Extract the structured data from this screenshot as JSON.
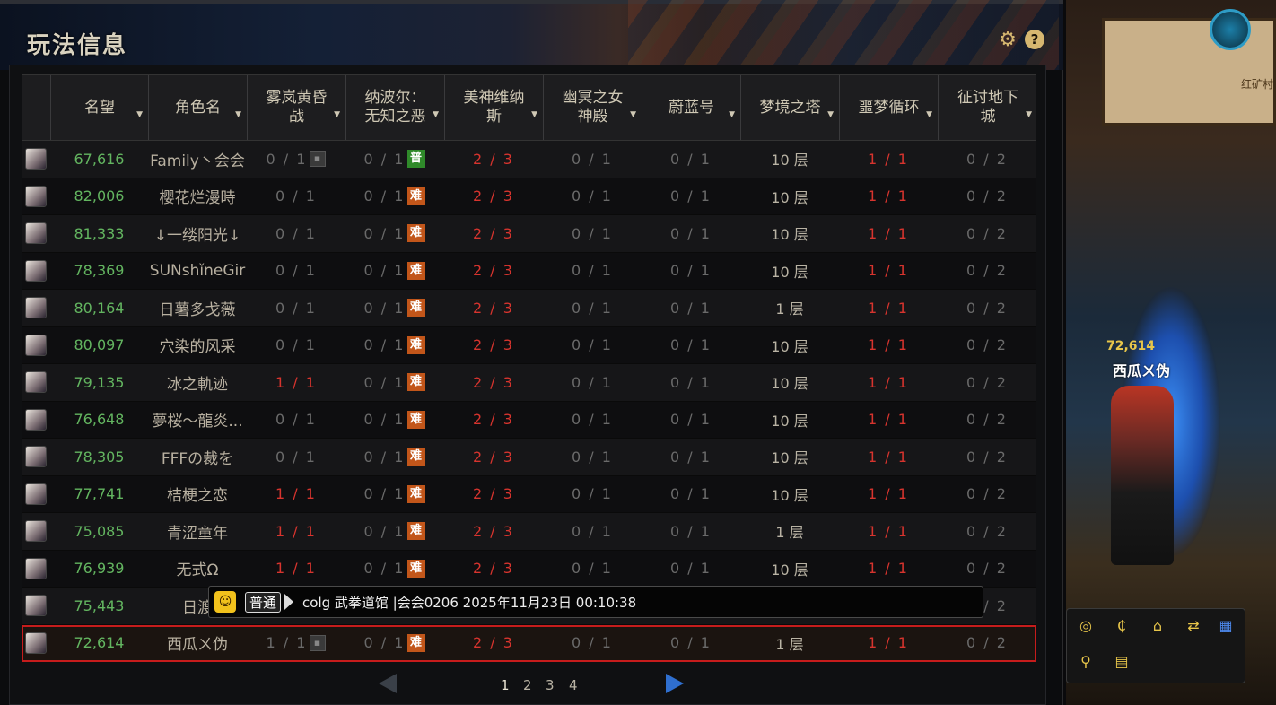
{
  "window": {
    "title": "玩法信息"
  },
  "header": {
    "columns": [
      {
        "label": "名望"
      },
      {
        "label": "角色名"
      },
      {
        "label": "雾岚黄昏战"
      },
      {
        "label": "纳波尔：无知之恶"
      },
      {
        "label": "美神维纳斯"
      },
      {
        "label": "幽冥之女神殿"
      },
      {
        "label": "蔚蓝号"
      },
      {
        "label": "梦境之塔"
      },
      {
        "label": "噩梦循环"
      },
      {
        "label": "征讨地下城"
      }
    ]
  },
  "rows": [
    {
      "fame": "67,616",
      "name": "Family丶会会",
      "c1": "0 / 1",
      "c1_lock": "🔒",
      "c2": "0 / 1",
      "c2_tag": "普",
      "c3": "2 / 3",
      "c4": "0 / 1",
      "c5": "0 / 1",
      "c6": "10 层",
      "c7": "1 / 1",
      "c8": "0 / 2"
    },
    {
      "fame": "82,006",
      "name": "樱花烂漫時",
      "c1": "0 / 1",
      "c2": "0 / 1",
      "c2_tag": "难",
      "c3": "2 / 3",
      "c4": "0 / 1",
      "c5": "0 / 1",
      "c6": "10 层",
      "c7": "1 / 1",
      "c8": "0 / 2"
    },
    {
      "fame": "81,333",
      "name": "↓一缕阳光↓",
      "c1": "0 / 1",
      "c2": "0 / 1",
      "c2_tag": "难",
      "c3": "2 / 3",
      "c4": "0 / 1",
      "c5": "0 / 1",
      "c6": "10 层",
      "c7": "1 / 1",
      "c8": "0 / 2"
    },
    {
      "fame": "78,369",
      "name": "SUNshǐneGir",
      "c1": "0 / 1",
      "c2": "0 / 1",
      "c2_tag": "难",
      "c3": "2 / 3",
      "c4": "0 / 1",
      "c5": "0 / 1",
      "c6": "10 层",
      "c7": "1 / 1",
      "c8": "0 / 2"
    },
    {
      "fame": "80,164",
      "name": "日薯多戈薇",
      "c1": "0 / 1",
      "c2": "0 / 1",
      "c2_tag": "难",
      "c3": "2 / 3",
      "c4": "0 / 1",
      "c5": "0 / 1",
      "c6": "1 层",
      "c7": "1 / 1",
      "c8": "0 / 2"
    },
    {
      "fame": "80,097",
      "name": "穴染的风采",
      "c1": "0 / 1",
      "c2": "0 / 1",
      "c2_tag": "难",
      "c3": "2 / 3",
      "c4": "0 / 1",
      "c5": "0 / 1",
      "c6": "10 层",
      "c7": "1 / 1",
      "c8": "0 / 2"
    },
    {
      "fame": "79,135",
      "name": "冰之軌迹",
      "c1": "1 / 1",
      "c1_red": true,
      "c2": "0 / 1",
      "c2_tag": "难",
      "c3": "2 / 3",
      "c4": "0 / 1",
      "c5": "0 / 1",
      "c6": "10 层",
      "c7": "1 / 1",
      "c8": "0 / 2"
    },
    {
      "fame": "76,648",
      "name": "夢桜～龍炎...",
      "c1": "0 / 1",
      "c2": "0 / 1",
      "c2_tag": "难",
      "c3": "2 / 3",
      "c4": "0 / 1",
      "c5": "0 / 1",
      "c6": "10 层",
      "c7": "1 / 1",
      "c8": "0 / 2"
    },
    {
      "fame": "78,305",
      "name": "FFFの裁を",
      "c1": "0 / 1",
      "c2": "0 / 1",
      "c2_tag": "难",
      "c3": "2 / 3",
      "c4": "0 / 1",
      "c5": "0 / 1",
      "c6": "10 层",
      "c7": "1 / 1",
      "c8": "0 / 2"
    },
    {
      "fame": "77,741",
      "name": "桔梗之恋",
      "c1": "1 / 1",
      "c1_red": true,
      "c2": "0 / 1",
      "c2_tag": "难",
      "c3": "2 / 3",
      "c4": "0 / 1",
      "c5": "0 / 1",
      "c6": "10 层",
      "c7": "1 / 1",
      "c8": "0 / 2"
    },
    {
      "fame": "75,085",
      "name": "青涩童年",
      "c1": "1 / 1",
      "c1_red": true,
      "c2": "0 / 1",
      "c2_tag": "难",
      "c3": "2 / 3",
      "c4": "0 / 1",
      "c5": "0 / 1",
      "c6": "1 层",
      "c7": "1 / 1",
      "c8": "0 / 2"
    },
    {
      "fame": "76,939",
      "name": "无式Ω",
      "c1": "1 / 1",
      "c1_red": true,
      "c2": "0 / 1",
      "c2_tag": "难",
      "c3": "2 / 3",
      "c4": "0 / 1",
      "c5": "0 / 1",
      "c6": "10 层",
      "c7": "1 / 1",
      "c8": "0 / 2"
    },
    {
      "fame": "75,443",
      "name": "日渡",
      "c1": "",
      "c2": "",
      "c3": "",
      "c4": "",
      "c5": "",
      "c6": "",
      "c7": "",
      "c8": "0 / 2"
    },
    {
      "fame": "72,614",
      "name": "西瓜ㄨ伪",
      "c1": "1 / 1",
      "c1_lock": "🔒",
      "c2": "0 / 1",
      "c2_tag": "难",
      "c3": "2 / 3",
      "c4": "0 / 1",
      "c5": "0 / 1",
      "c6": "1 层",
      "c7": "1 / 1",
      "c8": "0 / 2",
      "selected": true
    }
  ],
  "tooltip": {
    "badge": "普通",
    "text": "colg  武拳道馆 |会会0206  2025年11月23日  00:10:38"
  },
  "pager": {
    "pages": [
      "1",
      "2",
      "3",
      "4"
    ],
    "current": "1"
  },
  "side": {
    "village": "红矿村",
    "char_level": "72,614",
    "char_name": "西瓜ㄨ伪"
  }
}
